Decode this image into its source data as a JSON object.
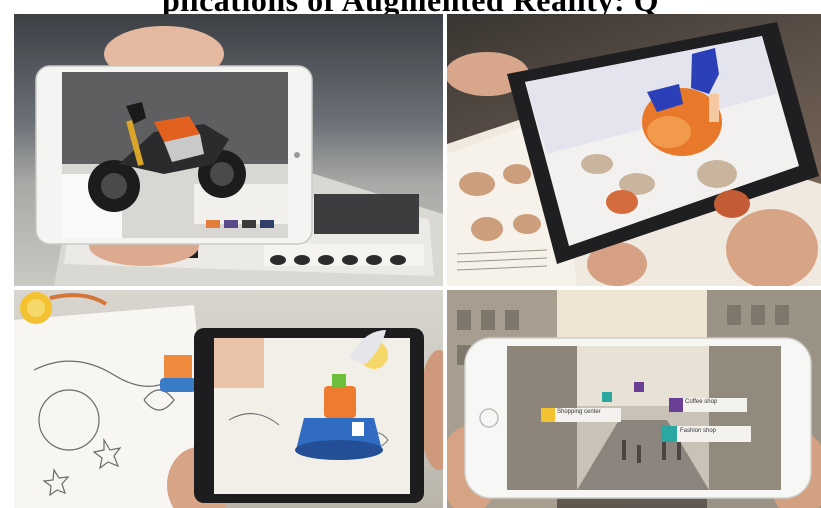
{
  "banner": {
    "text": "plications of Augmented Reality: Q"
  },
  "panels": [
    {
      "scene": "motorcycle-product-catalog-ar"
    },
    {
      "scene": "anatomy-book-3d-heart-ar"
    },
    {
      "scene": "coloring-book-3d-character-ar"
    },
    {
      "scene": "street-navigation-poi-ar"
    }
  ],
  "poi_labels": {
    "coffee": "Coffee shop",
    "fashion": "Fashion shop",
    "shopping": "Shopping center"
  },
  "colors": {
    "motorcycle_orange": "#e2611f",
    "heart_orange": "#e8792a",
    "vessel_blue": "#2a3fb8",
    "poi_label_bg": "#f4f2ee",
    "poi_icon_purple": "#6a3f96",
    "poi_icon_teal": "#2aa7a0",
    "poi_icon_yellow": "#f2c230"
  }
}
